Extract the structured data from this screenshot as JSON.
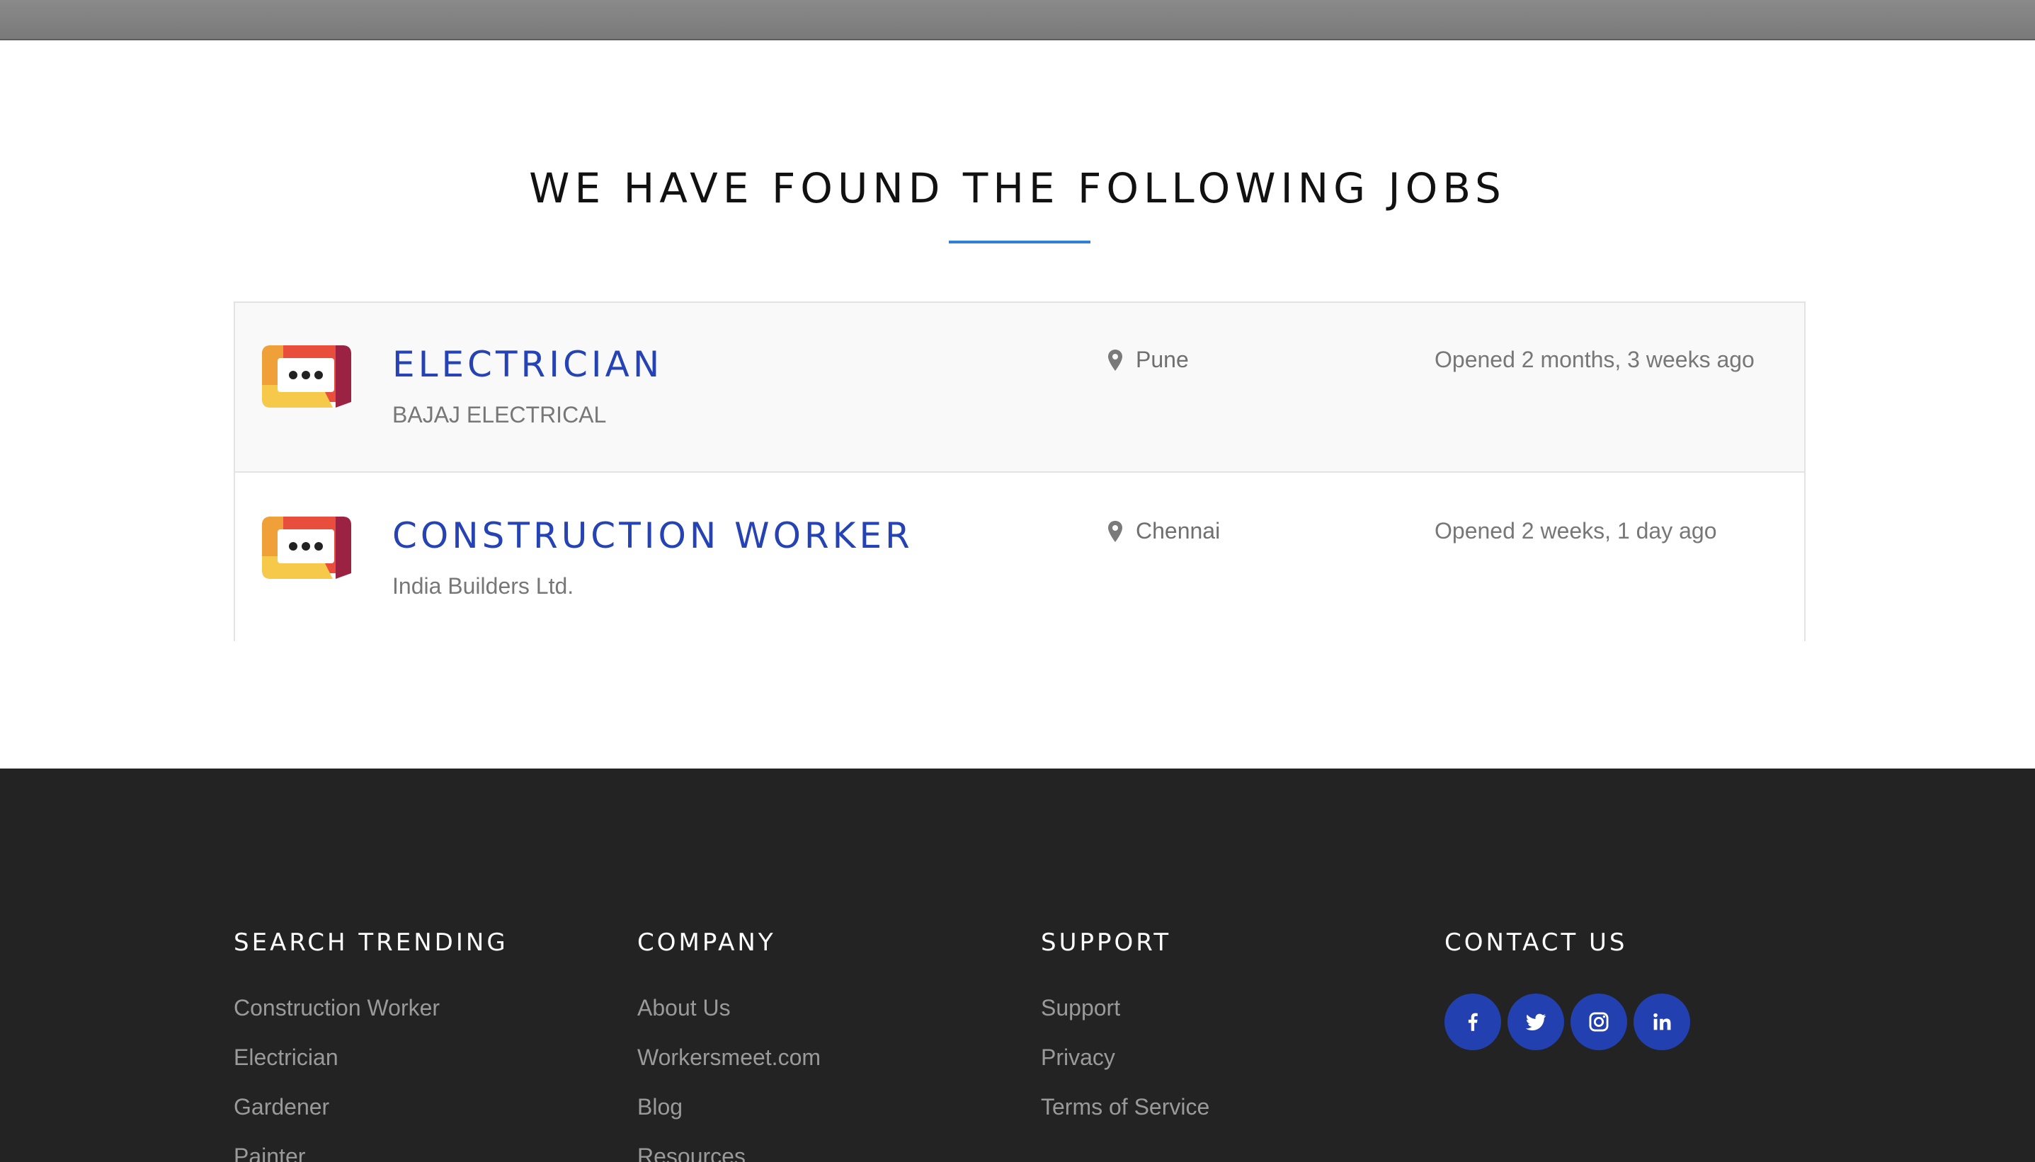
{
  "section": {
    "title": "WE HAVE FOUND THE FOLLOWING JOBS",
    "accent_color": "#2d7fd8"
  },
  "jobs": [
    {
      "title": "ELECTRICIAN",
      "company": "BAJAJ ELECTRICAL",
      "location": "Pune",
      "opened": "Opened 2 months, 3 weeks ago",
      "logo_icon": "chat-bubble-icon"
    },
    {
      "title": "CONSTRUCTION WORKER",
      "company": "India Builders Ltd.",
      "location": "Chennai",
      "opened": "Opened 2 weeks, 1 day ago",
      "logo_icon": "chat-bubble-icon"
    }
  ],
  "footer": {
    "search_trending": {
      "heading": "SEARCH TRENDING",
      "links": [
        "Construction Worker",
        "Electrician",
        "Gardener",
        "Painter"
      ]
    },
    "company": {
      "heading": "COMPANY",
      "links": [
        "About Us",
        "Workersmeet.com",
        "Blog",
        "Resources"
      ]
    },
    "support": {
      "heading": "SUPPORT",
      "links": [
        "Support",
        "Privacy",
        "Terms of Service"
      ]
    },
    "contact": {
      "heading": "CONTACT US",
      "social": [
        "facebook-icon",
        "twitter-icon",
        "instagram-icon",
        "linkedin-icon"
      ],
      "button_color": "#2340b0"
    }
  },
  "colors": {
    "job_title": "#2543b5",
    "footer_bg": "#232323"
  }
}
